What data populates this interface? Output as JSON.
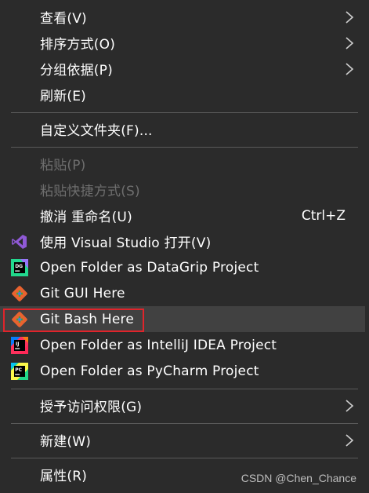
{
  "menu": {
    "view": "查看(V)",
    "sort_by": "排序方式(O)",
    "group_by": "分组依据(P)",
    "refresh": "刷新(E)",
    "customize_folder": "自定义文件夹(F)...",
    "paste": "粘贴(P)",
    "paste_shortcut": "粘贴快捷方式(S)",
    "undo_rename": "撤消 重命名(U)",
    "undo_shortcut": "Ctrl+Z",
    "open_with_vs": "使用 Visual Studio 打开(V)",
    "datagrip": "Open Folder as DataGrip Project",
    "git_gui": "Git GUI Here",
    "git_bash": "Git Bash Here",
    "intellij": "Open Folder as IntelliJ IDEA Project",
    "pycharm": "Open Folder as PyCharm Project",
    "give_access": "授予访问权限(G)",
    "new": "新建(W)",
    "properties": "属性(R)"
  },
  "icons": {
    "visual_studio": "visual-studio-icon",
    "datagrip": "datagrip-icon",
    "git_gui": "git-icon",
    "git_bash": "git-icon",
    "intellij": "intellij-icon",
    "pycharm": "pycharm-icon",
    "submenu": "chevron-right-icon"
  },
  "highlight_color": "#e0242b",
  "watermark": "CSDN @Chen_Chance"
}
